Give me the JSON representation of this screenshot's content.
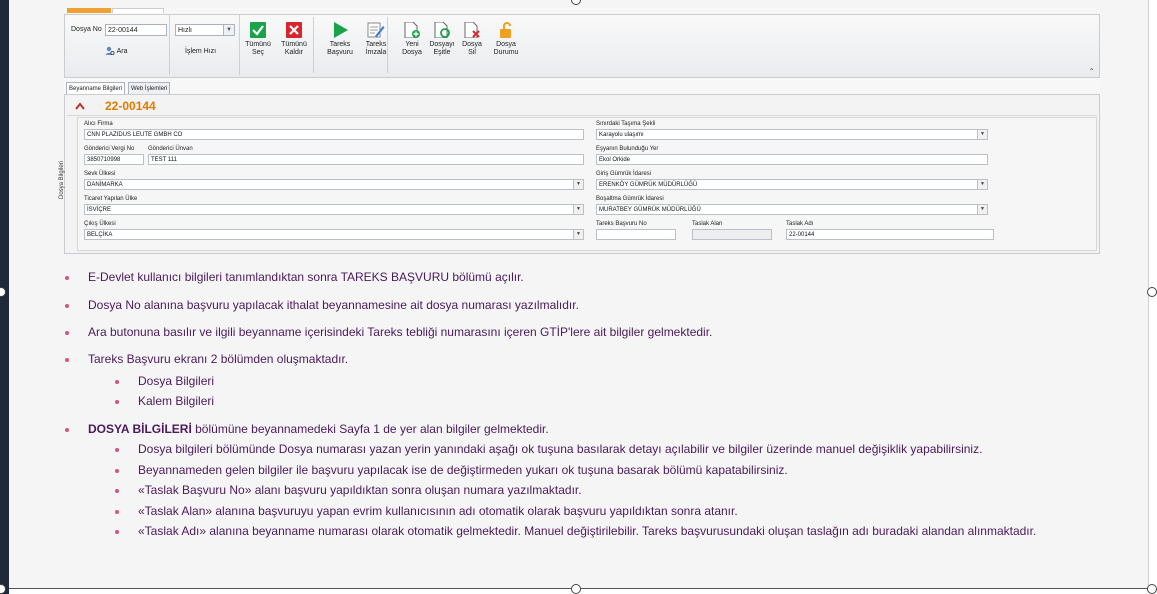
{
  "toolbar": {
    "dosya_no_label": "Dosya No",
    "dosya_no_value": "22-00144",
    "ara_label": "Ara",
    "speed_value": "Hızlı",
    "speed_label": "İşlem Hızı",
    "buttons": [
      {
        "line1": "Tümünü",
        "line2": "Seç",
        "icon": "check-icon",
        "color": "#1aa34a"
      },
      {
        "line1": "Tümünü",
        "line2": "Kaldır",
        "icon": "x-icon",
        "color": "#d9262c"
      },
      {
        "line1": "Tareks",
        "line2": "Başvuru",
        "icon": "play-icon",
        "color": "#1aa34a"
      },
      {
        "line1": "Tareks",
        "line2": "İmzala",
        "icon": "sign-icon",
        "color": "#3c7fd1"
      },
      {
        "line1": "Yeni",
        "line2": "Dosya",
        "icon": "new-file-icon",
        "color": "#1aa34a"
      },
      {
        "line1": "Dosyayı",
        "line2": "Eşitle",
        "icon": "sync-icon",
        "color": "#1aa34a"
      },
      {
        "line1": "Dosya",
        "line2": "Sil",
        "icon": "delete-file-icon",
        "color": "#d9262c"
      },
      {
        "line1": "Dosya",
        "line2": "Durumu",
        "icon": "lock-icon",
        "color": "#f0a020"
      }
    ]
  },
  "tabs": [
    "Beyanname Bilgileri",
    "Web İşlemleri"
  ],
  "doc_title": "22-00144",
  "side_label": "Dosya Bilgileri",
  "form": {
    "alici_firma": {
      "label": "Alıcı Firma",
      "value": "CNN PLAZIDUS LEUTE GMBH CO"
    },
    "gonderici_vergi": {
      "label": "Gönderici Vergi No",
      "value": "3850710998"
    },
    "gonderici_unvan": {
      "label": "Gönderici Ünvan",
      "value": "TEST 111"
    },
    "sevk_ulkesi": {
      "label": "Sevk Ülkesi",
      "value": "DANİMARKA"
    },
    "ticaret_ulke": {
      "label": "Ticaret Yapılan Ülke",
      "value": "İSVİÇRE"
    },
    "cikis_ulkesi": {
      "label": "Çıkış Ülkesi",
      "value": "BELÇİKA"
    },
    "tasima_sekli": {
      "label": "Sınırdaki Taşıma Şekli",
      "value": "Karayolu ulaşımı"
    },
    "esya_yer": {
      "label": "Eşyanın Bulunduğu Yer",
      "value": "Ekol Orkide"
    },
    "giris_gumruk": {
      "label": "Giriş Gümrük İdaresi",
      "value": "ERENKÖY GÜMRÜK MÜDÜRLÜĞÜ"
    },
    "bosaltma_gumruk": {
      "label": "Boşaltma Gümrük İdaresi",
      "value": "MURATBEY GÜMRÜK MÜDÜRLÜĞÜ"
    },
    "tareks_no": {
      "label": "Tareks Başvuru No",
      "value": ""
    },
    "taslak_alan": {
      "label": "Taslak Alan",
      "value": ""
    },
    "taslak_adi": {
      "label": "Taslak Adı",
      "value": "22-00144"
    }
  },
  "bullets": {
    "b1": "E-Devlet kullanıcı bilgileri tanımlandıktan sonra TAREKS BAŞVURU bölümü açılır.",
    "b2": "Dosya No alanına başvuru yapılacak ithalat beyannamesine ait dosya numarası yazılmalıdır.",
    "b3": "Ara butonuna basılır ve ilgili beyanname içerisindeki Tareks tebliği numarasını içeren GTİP'lere ait bilgiler gelmektedir.",
    "b4": "Tareks Başvuru ekranı 2 bölümden oluşmaktadır.",
    "b4a": "Dosya Bilgileri",
    "b4b": "Kalem Bilgileri",
    "b5_bold": "DOSYA BİLGİLERİ",
    "b5_rest": " bölümüne beyannamedeki Sayfa 1 de yer alan bilgiler gelmektedir.",
    "b5a": "Dosya bilgileri bölümünde Dosya numarası yazan yerin yanındaki aşağı ok tuşuna basılarak detayı açılabilir ve bilgiler üzerinde manuel değişiklik yapabilirsiniz.",
    "b5b": "Beyannameden gelen bilgiler ile başvuru yapılacak ise de değiştirmeden yukarı ok tuşuna basarak bölümü kapatabilirsiniz.",
    "b5c": "«Taslak Başvuru No» alanı başvuru yapıldıktan sonra oluşan numara yazılmaktadır.",
    "b5d": "«Taslak Alan»  alanına başvuruyu yapan evrim kullanıcısının adı otomatik olarak başvuru yapıldıktan sonra atanır.",
    "b5e": "«Taslak Adı» alanına beyanname numarası olarak otomatik gelmektedir. Manuel değiştirilebilir. Tareks başvurusundaki oluşan taslağın adı buradaki alandan alınmaktadır."
  }
}
